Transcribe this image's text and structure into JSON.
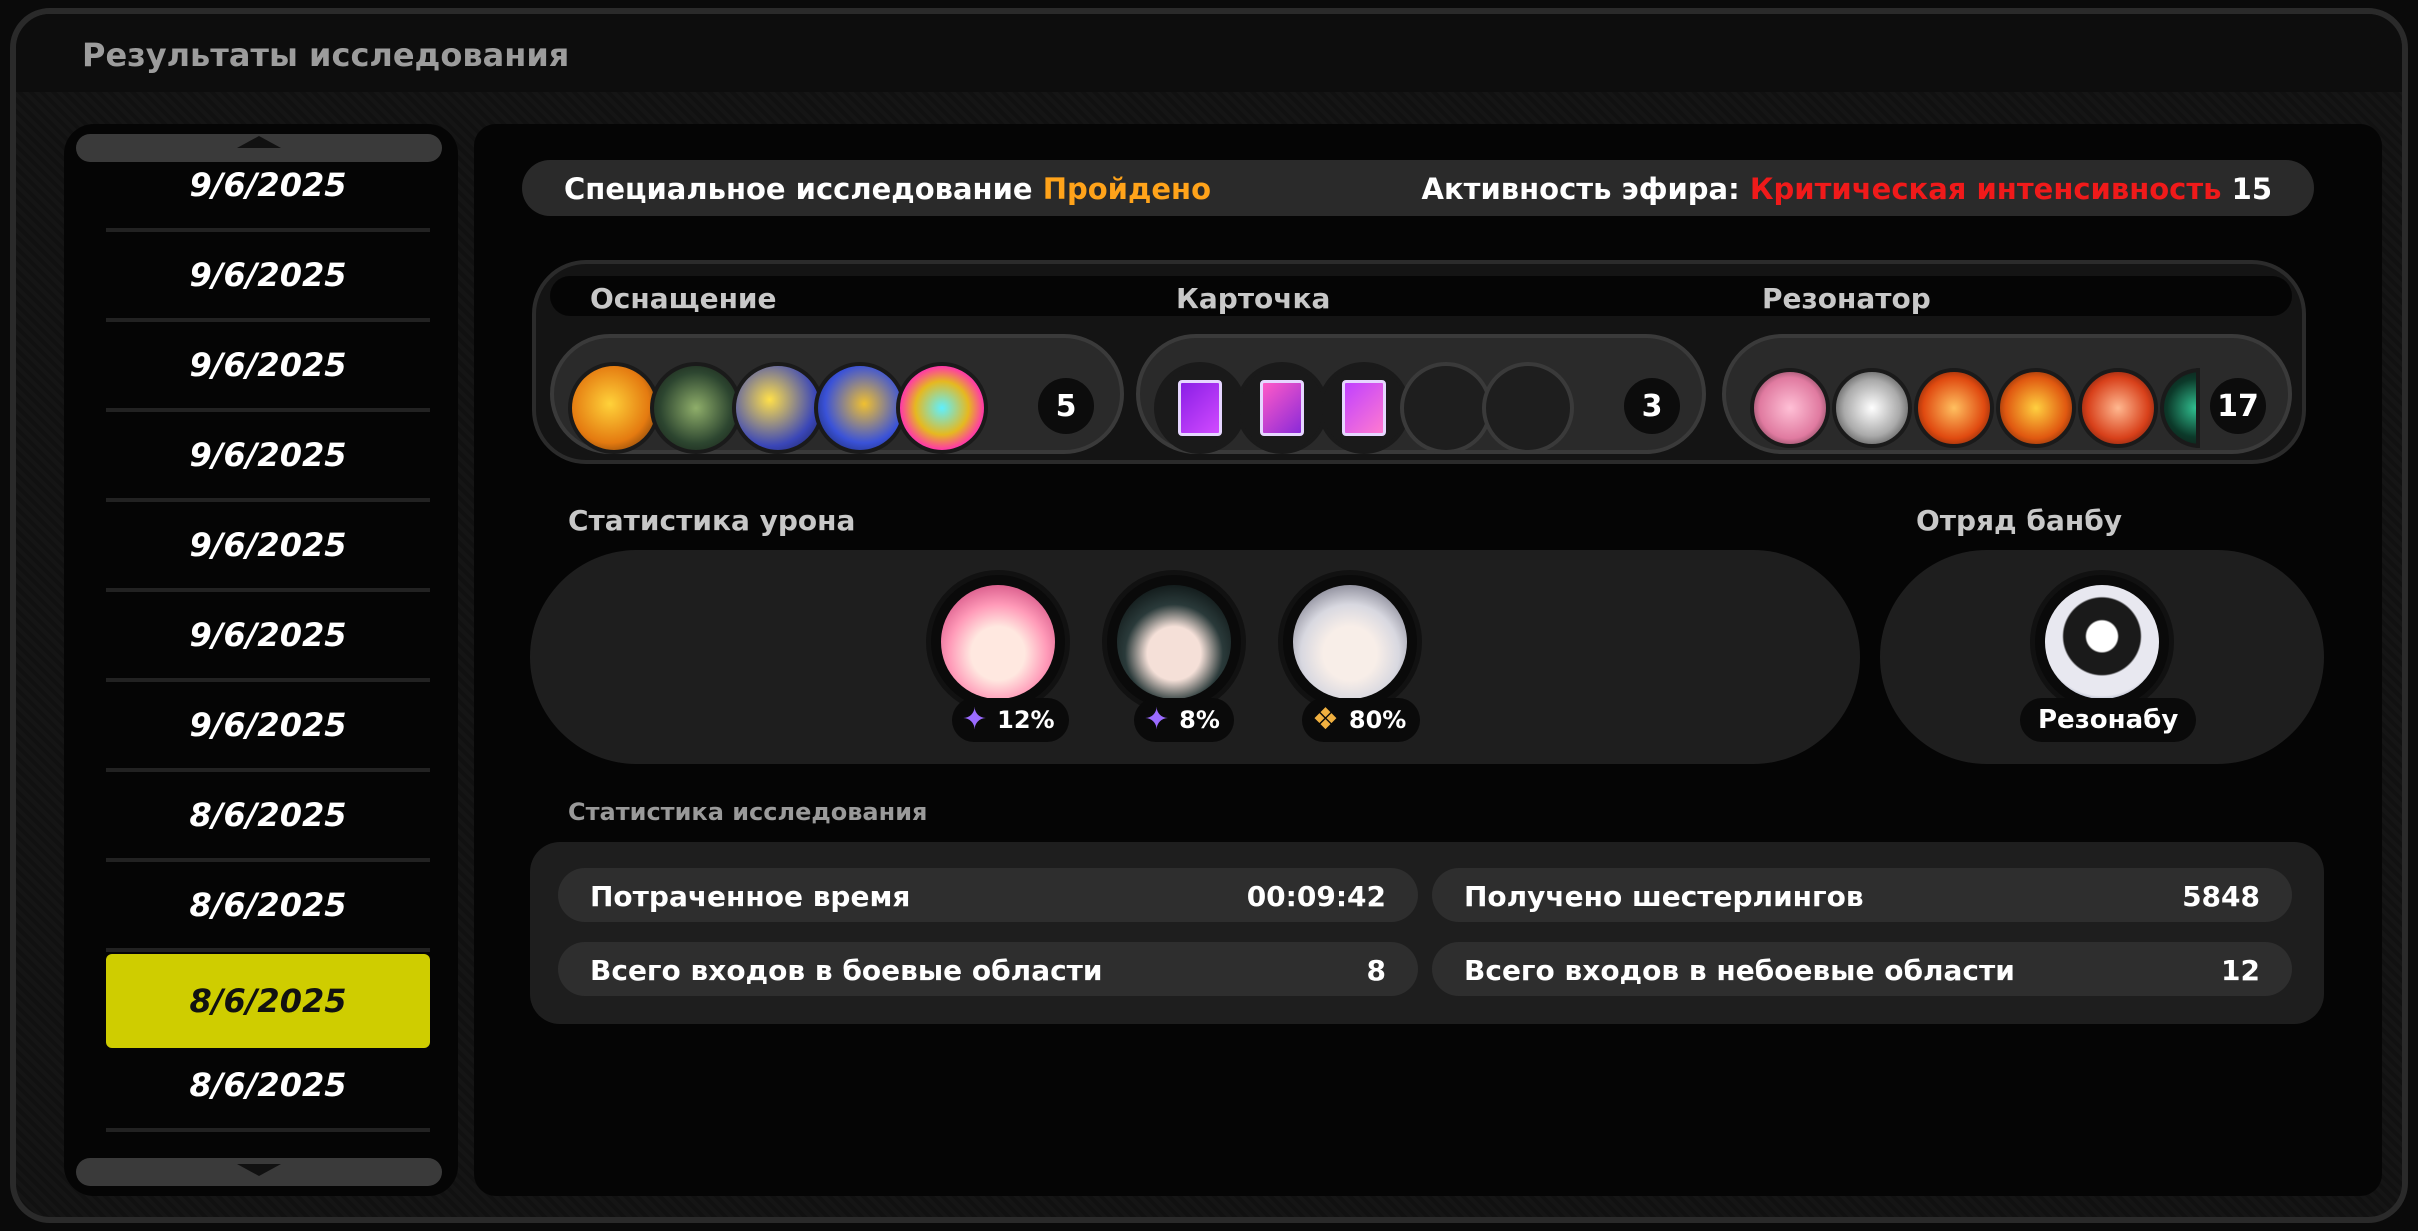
{
  "window": {
    "title": "Результаты исследования"
  },
  "dates": [
    "9/6/2025",
    "9/6/2025",
    "9/6/2025",
    "9/6/2025",
    "9/6/2025",
    "9/6/2025",
    "9/6/2025",
    "8/6/2025",
    "8/6/2025",
    "8/6/2025",
    "8/6/2025"
  ],
  "selected_date_index": 9,
  "status": {
    "special_label": "Специальное исследование",
    "special_value": "Пройдено",
    "ether_label": "Активность эфира:",
    "ether_value": "Критическая интенсивность",
    "ether_level": "15"
  },
  "equipment": {
    "gear_label": "Оснащение",
    "gear_count": "5",
    "card_label": "Карточка",
    "card_count": "3",
    "resonator_label": "Резонатор",
    "resonator_count": "17"
  },
  "damage": {
    "title": "Статистика урона",
    "agents": [
      {
        "name": "agent-pink-hair",
        "icon": "ether-sparkle-icon",
        "percent": "12%"
      },
      {
        "name": "agent-dark-hair",
        "icon": "ether-sparkle-icon",
        "percent": "8%"
      },
      {
        "name": "agent-white-hair",
        "icon": "attack-diamond-icon",
        "percent": "80%"
      }
    ]
  },
  "bangboo": {
    "title": "Отряд банбу",
    "name": "Резонабу"
  },
  "research": {
    "title": "Статистика исследования",
    "time_label": "Потраченное время",
    "time_value": "00:09:42",
    "gears_label": "Получено шестерлингов",
    "gears_value": "5848",
    "combat_label": "Всего входов в боевые области",
    "combat_value": "8",
    "noncombat_label": "Всего входов в небоевые области",
    "noncombat_value": "12"
  },
  "colors": {
    "accent_yellow": "#cfcd00",
    "status_orange": "#ffa31a",
    "status_red": "#f01a1a"
  }
}
